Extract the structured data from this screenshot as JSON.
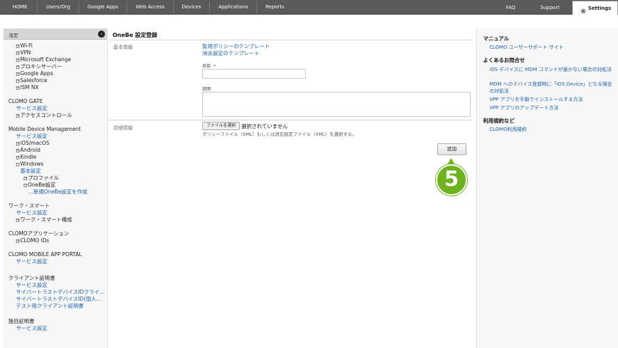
{
  "topnav": {
    "tabs": [
      "HOME",
      "Users/Org",
      "Google Apps",
      "Web Access",
      "Devices",
      "Applications",
      "Reports"
    ],
    "right": [
      "FAQ",
      "Support"
    ],
    "settings_label": "Settings"
  },
  "sidebar": {
    "header": "設定",
    "collapse_glyph": "‹",
    "top_items": [
      "Wi-Fi",
      "VPN",
      "Microsoft Exchange",
      "プロキシサーバー",
      "Google Apps",
      "Salesforce",
      "ISM NX"
    ],
    "gate": {
      "title": "CLOMO GATE",
      "service": "サービス設定",
      "access": "アクセスコントロール"
    },
    "mdm": {
      "title": "Mobile Device Management",
      "service": "サービス設定",
      "items": [
        "iOS/macOS",
        "Android",
        "Kindle",
        "Windows"
      ],
      "windows_basic": "基本設定",
      "windows_profile": "プロファイル",
      "windows_onebe": "OneBe設定",
      "windows_new": "...新規OneBe設定を作成"
    },
    "work": {
      "title": "ワーク・スマート",
      "service": "サービス設定",
      "config": "ワーク・スマート構成"
    },
    "apps": {
      "title": "CLOMOアプリケーション",
      "ids": "CLOMO IDs"
    },
    "portal": {
      "title": "CLOMO MOBILE APP PORTAL",
      "service": "サービス設定"
    },
    "cert": {
      "title": "クライアント証明書",
      "service": "サービス設定",
      "cyber1": "サイバートラストデバイスIDクライ...",
      "cyber2": "サイバートラストデバイスID(個人...",
      "test": "テスト用クライアント証明書"
    },
    "own": {
      "title": "独自証明書",
      "service": "サービス設定"
    }
  },
  "main": {
    "title": "OneBe 設定登録",
    "basic_label": "基本情報",
    "template_link1": "監視ポリシーのテンプレート",
    "template_link2": "消去設定のテンプレート",
    "name_label": "名前",
    "required_mark": "*",
    "name_value": "",
    "desc_label": "説明",
    "desc_value": "",
    "detail_label": "詳細情報",
    "file_button": "ファイルを選択",
    "file_status": "選択されていません",
    "file_hint": "ポリシーファイル（XML）もしくは消去設定ファイル（XML）を選択する。",
    "add_button": "追加",
    "step_number": "5"
  },
  "rightpanel": {
    "manual_title": "マニュアル",
    "manual_link": "CLOMO ユーザーサポート サイト",
    "faq_title": "よくあるお問合せ",
    "faq_links": [
      "iOS デバイスに MDM コマンドが届かない場合の対処法",
      "MDM へのデバイス登録時に「iOS Device」となる場合の対処法",
      "VPP アプリを手動でインストールする方法",
      "VPP アプリのアップデート方法"
    ],
    "terms_title": "利用規約など",
    "terms_link": "CLOMO利用規約"
  },
  "colors": {
    "topbar": "#5a5a5a",
    "link": "#1b5faa",
    "badge": "#6fb21f",
    "required": "#d0202e"
  }
}
